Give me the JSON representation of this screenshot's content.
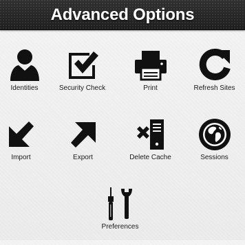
{
  "header": {
    "title": "Advanced Options"
  },
  "colors": {
    "icon": "#111111",
    "background": "#f1f1f1",
    "titlebar": "#262626",
    "title_text": "#ffffff"
  },
  "items": [
    {
      "label": "Identities",
      "icon": "person-icon"
    },
    {
      "label": "Security Check",
      "icon": "checkbox-icon"
    },
    {
      "label": "Print",
      "icon": "printer-icon"
    },
    {
      "label": "Refresh Sites",
      "icon": "refresh-icon"
    },
    {
      "label": "Import",
      "icon": "arrow-down-left-icon"
    },
    {
      "label": "Export",
      "icon": "arrow-up-right-icon"
    },
    {
      "label": "Delete Cache",
      "icon": "delete-cache-icon"
    },
    {
      "label": "Sessions",
      "icon": "globe-icon"
    },
    {
      "label": "Preferences",
      "icon": "tools-icon"
    }
  ]
}
